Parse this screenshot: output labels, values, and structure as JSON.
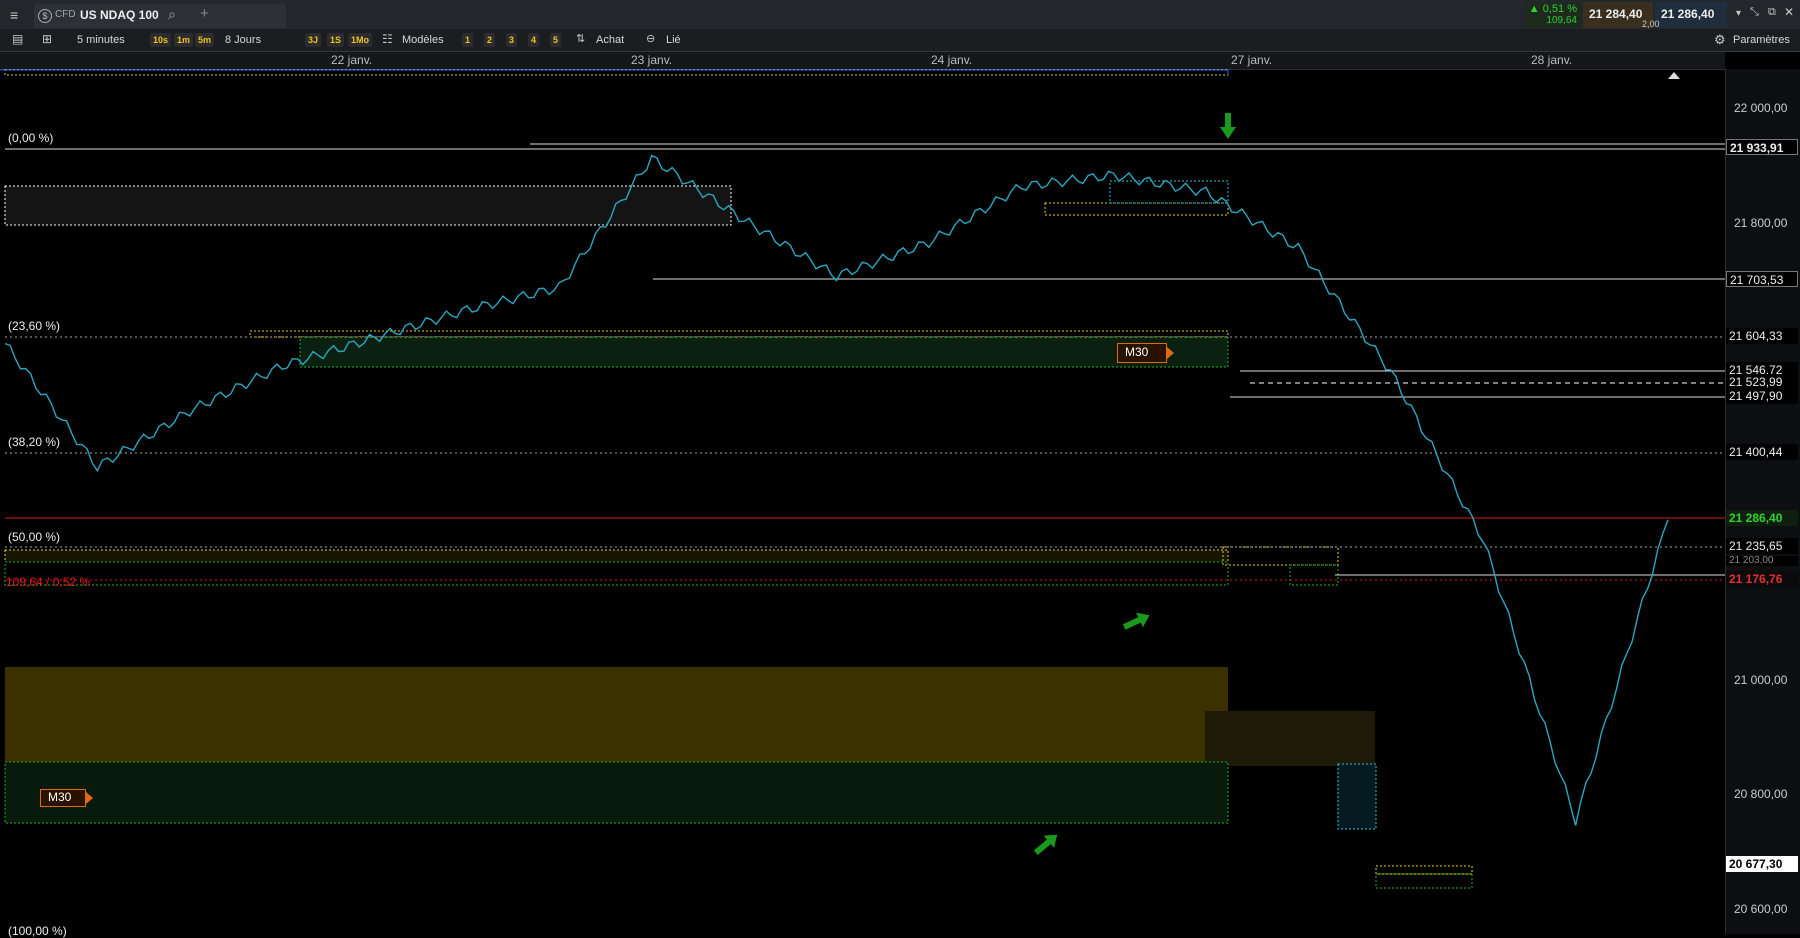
{
  "header": {
    "instrument_type": "CFD",
    "instrument_name": "US NDAQ 100",
    "change_pct": "▲ 0,51 %",
    "change_abs": "109,64",
    "bid": "21 284,40",
    "ask": "21 286,40",
    "spread": "2,00"
  },
  "toolbar": {
    "interval": "5 minutes",
    "interval_chips": [
      "10s",
      "1m",
      "5m"
    ],
    "range": "8 Jours",
    "range_chips": [
      "3J",
      "1S",
      "1Mo"
    ],
    "models": "Modèles",
    "model_chips": [
      "1",
      "2",
      "3",
      "4",
      "5"
    ],
    "buy": "Achat",
    "linked": "Lié",
    "settings": "Paramètres"
  },
  "time_axis": [
    "22 janv.",
    "23 janv.",
    "24 janv.",
    "27 janv.",
    "28 janv."
  ],
  "price_axis": [
    "22 000,00",
    "21 800,00",
    "21 000,00",
    "20 800,00",
    "20 600,00"
  ],
  "price_levels": [
    "21 933,91",
    "21 703,53",
    "21 604,33",
    "21 546,72",
    "21 523,99",
    "21 497,90",
    "21 400,44",
    "21 235,65",
    "20 677,30"
  ],
  "current_price": "21 286,40",
  "ref_price": "21 176,76",
  "hidden_price": "21 203,00",
  "fib_levels": [
    "(0,00 %)",
    "(23,60 %)",
    "(38,20 %)",
    "(50,00 %)",
    "(100,00 %)"
  ],
  "change_line": "109,64 / 0,52 %",
  "markers": [
    "M30",
    "M30"
  ],
  "colors": {
    "up": "#1fc41f",
    "down": "#e01919",
    "candle": "#29a3b8",
    "zone_yellow": "#3a2f00",
    "zone_green": "#0c2612"
  },
  "chart_data": {
    "type": "line",
    "title": "",
    "xlabel": "",
    "ylabel": "",
    "ylim": [
      20580,
      22050
    ],
    "x": [
      "22 janv.",
      "",
      "",
      "",
      "23 janv.",
      "",
      "",
      "",
      "24 janv.",
      "",
      "",
      "",
      "27 janv.",
      "",
      "",
      "",
      "28 janv.",
      "",
      ""
    ],
    "series": [
      {
        "values": [
          21600,
          21380,
          21480,
          21560,
          21610,
          21660,
          21700,
          21930,
          21820,
          21720,
          21780,
          21880,
          21900,
          21870,
          21770,
          21550,
          21250,
          20750,
          21286
        ]
      }
    ]
  }
}
